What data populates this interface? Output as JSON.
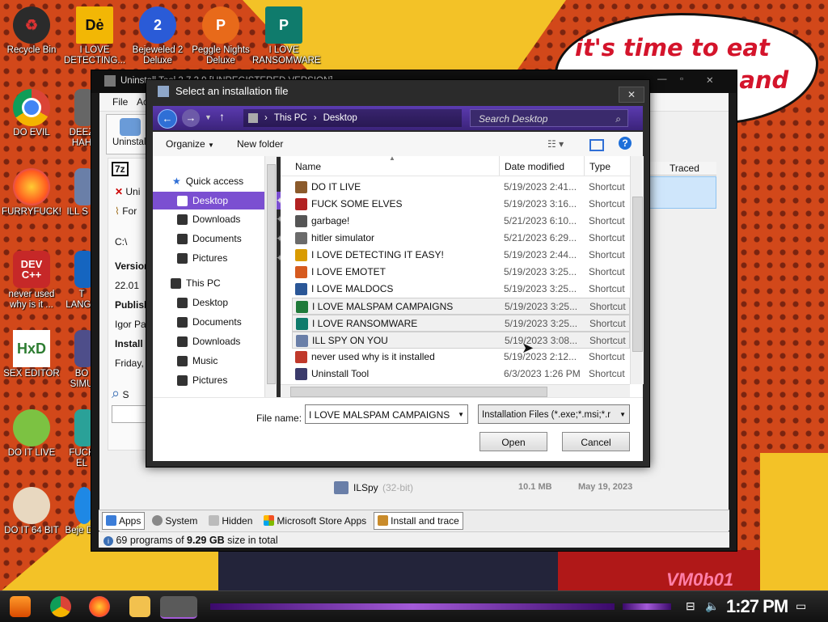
{
  "desktop": {
    "speech_text": "it's time to eat shit and die and chew",
    "watermark": "VM0b01",
    "icons": [
      {
        "label": "Recycle Bin"
      },
      {
        "label": "I LOVE DETECTING..."
      },
      {
        "label": "Bejeweled 2 Deluxe"
      },
      {
        "label": "Peggle Nights Deluxe"
      },
      {
        "label": "I LOVE RANSOMWARE"
      },
      {
        "label": "DO EVIL"
      },
      {
        "label": "DEEZ HAH"
      },
      {
        "label": "FURRYFUCK!"
      },
      {
        "label": "ILL S Y"
      },
      {
        "label": "never used why is it ..."
      },
      {
        "label": "T LANGU"
      },
      {
        "label": "SEX EDITOR"
      },
      {
        "label": "BO SIMU"
      },
      {
        "label": "DO IT LIVE"
      },
      {
        "label": "FUCK EL"
      },
      {
        "label": "DO IT 64 BIT"
      },
      {
        "label": "Beje De"
      }
    ]
  },
  "uninstaller": {
    "title": "Uninstall Tool 3.7.3.9 [UNREGISTERED VERSION]",
    "menu_file": "File",
    "menu_ac": "Ac",
    "uninstall_label": "Uninstall",
    "side_7z": "7z",
    "side_uni": "Uni",
    "side_for": "For",
    "side_path": "C:\\",
    "version_label": "Version",
    "version_value": "22.01",
    "publisher_label": "Publish",
    "publisher_value": "Igor Pa",
    "installed_label": "Install",
    "installed_value": "Friday,",
    "search_s": "S",
    "col_traced": "Traced",
    "ilspy_name": "ILSpy",
    "ilspy_bits": "(32-bit)",
    "ilspy_size": "10.1 MB",
    "ilspy_date": "May 19, 2023",
    "tabs": [
      {
        "label": "Apps"
      },
      {
        "label": "System"
      },
      {
        "label": "Hidden"
      },
      {
        "label": "Microsoft Store Apps"
      },
      {
        "label": "Install and trace"
      }
    ],
    "status_prefix": "69 programs of",
    "status_size": "9.29 GB",
    "status_suffix": "size in total"
  },
  "dialog": {
    "title": "Select an installation file",
    "breadcrumb": [
      "This PC",
      "Desktop"
    ],
    "search_placeholder": "Search Desktop",
    "organize": "Organize",
    "new_folder": "New folder",
    "nav": {
      "quick_access": "Quick access",
      "qa_items": [
        "Desktop",
        "Downloads",
        "Documents",
        "Pictures"
      ],
      "this_pc": "This PC",
      "pc_items": [
        "Desktop",
        "Documents",
        "Downloads",
        "Music",
        "Pictures"
      ]
    },
    "columns": {
      "name": "Name",
      "date": "Date modified",
      "type": "Type"
    },
    "files": [
      {
        "name": "DO IT LIVE",
        "date": "5/19/2023 2:41...",
        "type": "Shortcut",
        "color": "#8b5a2b"
      },
      {
        "name": "FUCK SOME ELVES",
        "date": "5/19/2023 3:16...",
        "type": "Shortcut",
        "color": "#b22222"
      },
      {
        "name": "garbage!",
        "date": "5/21/2023 6:10...",
        "type": "Shortcut",
        "color": "#555555"
      },
      {
        "name": "hitler simulator",
        "date": "5/21/2023 6:29...",
        "type": "Shortcut",
        "color": "#6b6b6b"
      },
      {
        "name": "I LOVE DETECTING IT EASY!",
        "date": "5/19/2023 2:44...",
        "type": "Shortcut",
        "color": "#d99b00"
      },
      {
        "name": "I LOVE EMOTET",
        "date": "5/19/2023 3:25...",
        "type": "Shortcut",
        "color": "#d65a1f"
      },
      {
        "name": "I LOVE MALDOCS",
        "date": "5/19/2023 3:25...",
        "type": "Shortcut",
        "color": "#2b5797"
      },
      {
        "name": "I LOVE MALSPAM CAMPAIGNS",
        "date": "5/19/2023 3:25...",
        "type": "Shortcut",
        "color": "#1f7a3a"
      },
      {
        "name": "I LOVE RANSOMWARE",
        "date": "5/19/2023 3:25...",
        "type": "Shortcut",
        "color": "#0f7b6c"
      },
      {
        "name": "ILL SPY ON YOU",
        "date": "5/19/2023 3:08...",
        "type": "Shortcut",
        "color": "#6a7fa8"
      },
      {
        "name": "never used why is it installed",
        "date": "5/19/2023 2:12...",
        "type": "Shortcut",
        "color": "#c0392b"
      },
      {
        "name": "Uninstall Tool",
        "date": "6/3/2023 1:26 PM",
        "type": "Shortcut",
        "color": "#3b3b6b"
      }
    ],
    "filename_label": "File name:",
    "filename_value": "I LOVE MALSPAM CAMPAIGNS",
    "filetype_value": "Installation Files (*.exe;*.msi;*.r",
    "open_label": "Open",
    "cancel_label": "Cancel"
  },
  "taskbar": {
    "clock": "1:27 PM"
  }
}
